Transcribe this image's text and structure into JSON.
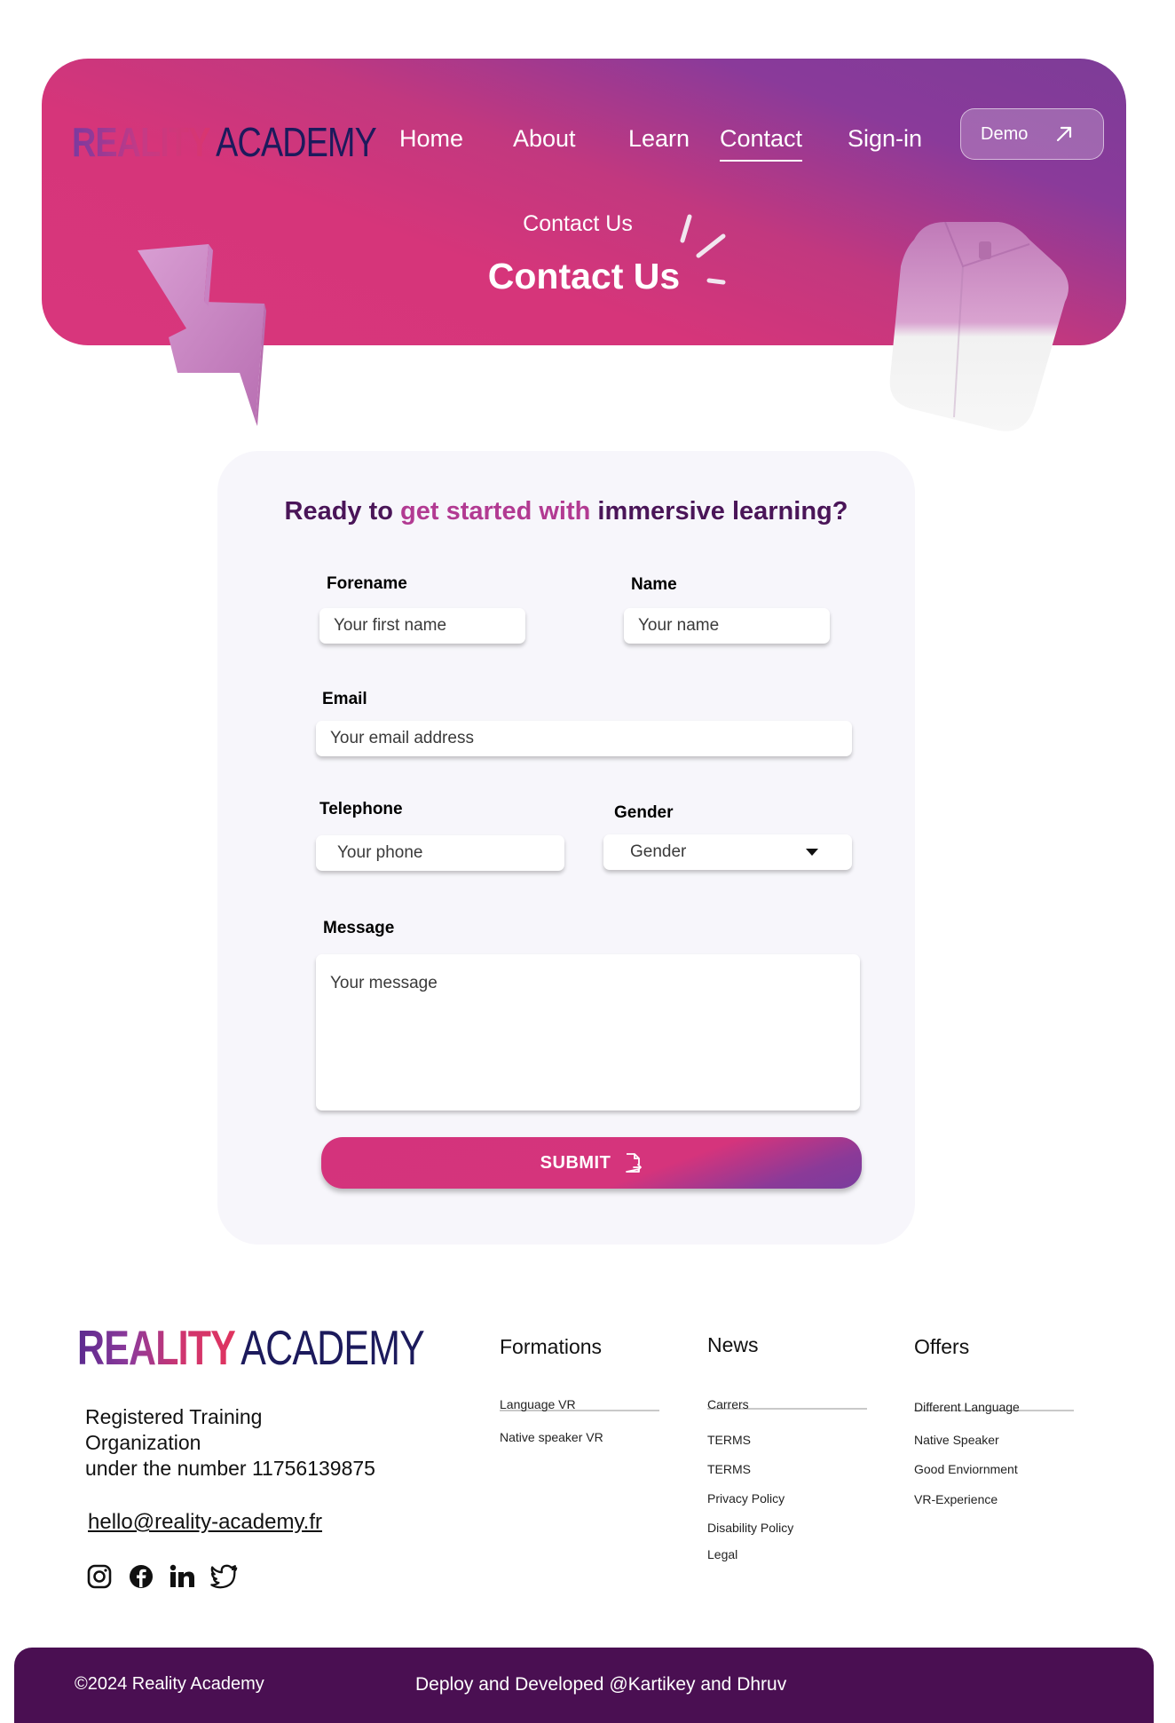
{
  "brand": {
    "part1": "REALITY",
    "part2": "ACADEMY"
  },
  "nav": {
    "items": [
      {
        "label": "Home"
      },
      {
        "label": "About"
      },
      {
        "label": "Learn"
      },
      {
        "label": "Contact"
      },
      {
        "label": "Sign-in"
      }
    ],
    "active": "Contact",
    "demo_label": "Demo"
  },
  "hero": {
    "eyebrow": "Contact Us",
    "title": "Contact Us"
  },
  "form": {
    "heading_parts": [
      "Ready to ",
      "get started with",
      " immersive learning?"
    ],
    "forename": {
      "label": "Forename",
      "placeholder": "Your first name"
    },
    "name": {
      "label": "Name",
      "placeholder": "Your name"
    },
    "email": {
      "label": "Email",
      "placeholder": "Your email address"
    },
    "telephone": {
      "label": "Telephone",
      "placeholder": "Your phone"
    },
    "gender": {
      "label": "Gender",
      "selected": "Gender"
    },
    "message": {
      "label": "Message",
      "placeholder": "Your message"
    },
    "submit_label": "SUBMIT"
  },
  "footer": {
    "registration_lines": [
      "Registered Training",
      "Organization",
      "under the number 11756139875"
    ],
    "email": "hello@reality-academy.fr",
    "socials": [
      "instagram-icon",
      "facebook-icon",
      "linkedin-icon",
      "twitter-icon"
    ],
    "columns": [
      {
        "title": "Formations",
        "items": [
          "Language VR",
          "Native speaker VR"
        ]
      },
      {
        "title": "News",
        "items": [
          "Carrers",
          "TERMS",
          "TERMS",
          "Privacy Policy",
          "Disability Policy",
          "Legal"
        ]
      },
      {
        "title": "Offers",
        "items": [
          "Different Language",
          "Native Speaker",
          "Good Enviornment",
          "VR-Experience"
        ]
      }
    ],
    "copyright": "©2024 Reality Academy",
    "credit": "Deploy and Developed @Kartikey and Dhruv"
  },
  "colors": {
    "brand_pink": "#d6357a",
    "brand_purple": "#7d3c98",
    "navy": "#1c1a5c",
    "footer_bar": "#4a0f52"
  }
}
